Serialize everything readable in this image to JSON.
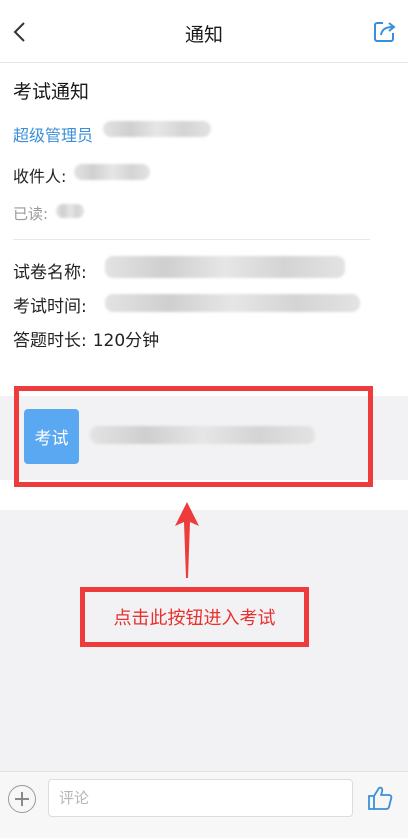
{
  "header": {
    "title": "通知"
  },
  "notice": {
    "title": "考试通知",
    "sender": "超级管理员",
    "recipient_label": "收件人:",
    "read_label": "已读:"
  },
  "details": {
    "paper_name_label": "试卷名称:",
    "exam_time_label": "考试时间:",
    "duration_label": "答题时长:",
    "duration_value": "120分钟"
  },
  "exam": {
    "button_label": "考试"
  },
  "annotation": {
    "callout_text": "点击此按钮进入考试"
  },
  "footer": {
    "comment_placeholder": "评论"
  },
  "colors": {
    "accent_blue": "#5aa7f2",
    "sender_blue": "#3b8fd9",
    "annotation_red": "#ee3b3b"
  }
}
